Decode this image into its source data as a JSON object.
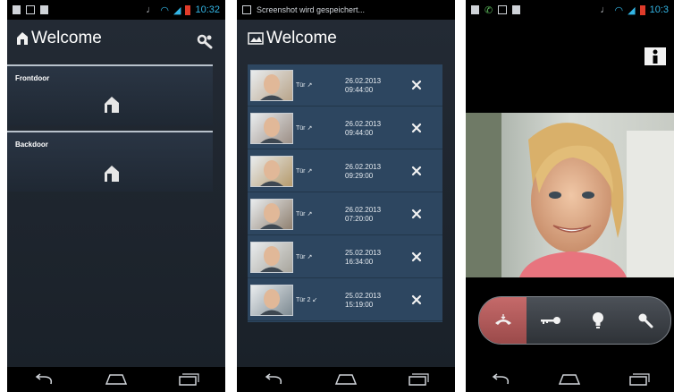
{
  "screen1": {
    "status_time": "10:32",
    "title": "Welcome",
    "doors": [
      {
        "label": "Frontdoor"
      },
      {
        "label": "Backdoor"
      }
    ],
    "icons": {
      "settings": "wrench-gear-icon",
      "house": "house-icon"
    }
  },
  "screen2": {
    "status_text": "Screenshot wird gespeichert...",
    "title": "Welcome",
    "rows": [
      {
        "label": "Tür",
        "date": "26.02.2013",
        "time": "09:44:00",
        "direction": "incoming"
      },
      {
        "label": "Tür",
        "date": "26.02.2013",
        "time": "09:44:00",
        "direction": "incoming"
      },
      {
        "label": "Tür",
        "date": "26.02.2013",
        "time": "09:29:00",
        "direction": "incoming"
      },
      {
        "label": "Tür",
        "date": "26.02.2013",
        "time": "07:20:00",
        "direction": "incoming"
      },
      {
        "label": "Tür",
        "date": "25.02.2013",
        "time": "16:34:00",
        "direction": "incoming"
      },
      {
        "label": "Tür 2",
        "date": "25.02.2013",
        "time": "15:19:00",
        "direction": "outgoing"
      }
    ]
  },
  "screen3": {
    "status_time": "10:3",
    "controls": [
      "hang-up-icon",
      "door-key-icon",
      "light-bulb-icon",
      "microphone-icon"
    ]
  },
  "colors": {
    "accent": "#33b5e5",
    "list_bg": "#2d4660",
    "hangup": "#b45b5b"
  }
}
